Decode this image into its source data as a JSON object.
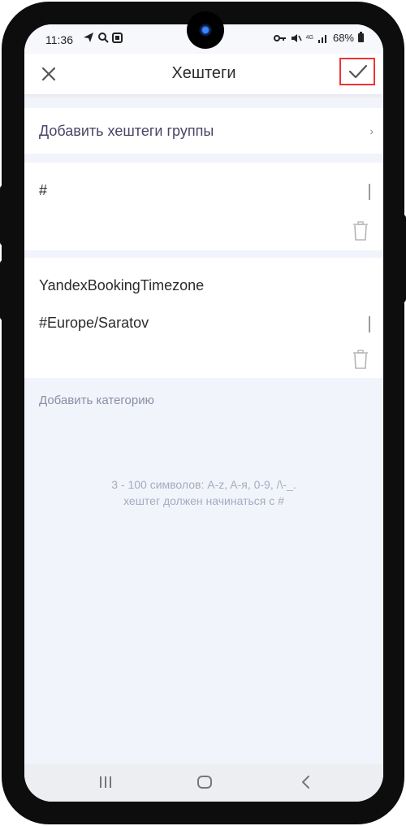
{
  "status_bar": {
    "time": "11:36",
    "battery": "68%",
    "network": "4G"
  },
  "header": {
    "title": "Хештеги"
  },
  "add_groups": {
    "label": "Добавить хештеги группы",
    "chevron": "›"
  },
  "tags": [
    {
      "name": "",
      "value": "#"
    },
    {
      "name": "YandexBookingTimezone",
      "value": "#Europe/Saratov"
    }
  ],
  "add_category": "Добавить категорию",
  "hint": {
    "line1": "3 - 100 символов: A-z, A-я, 0-9, /\\-_.",
    "line2": "хештег должен начинаться с #"
  },
  "colors": {
    "accent_border": "#e33333",
    "background": "#f1f4fa",
    "label_purple": "#4c4466"
  }
}
